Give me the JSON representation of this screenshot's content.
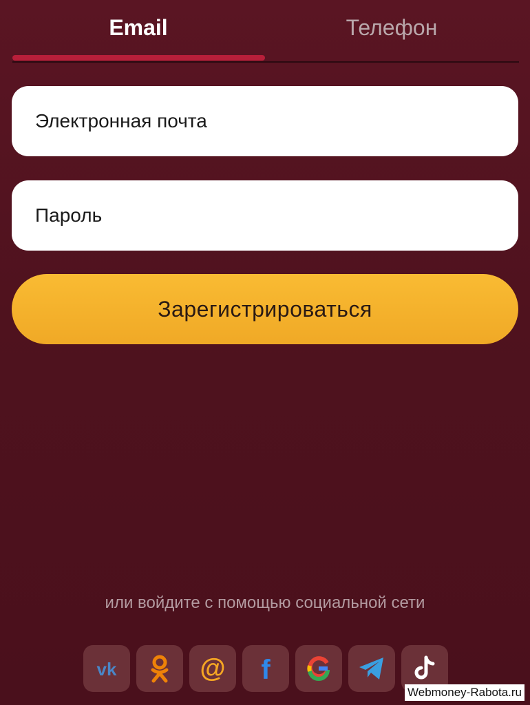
{
  "tabs": {
    "email_label": "Email",
    "phone_label": "Телефон",
    "active": "email"
  },
  "form": {
    "email_placeholder": "Электронная почта",
    "email_value": "",
    "password_placeholder": "Пароль",
    "password_value": "",
    "submit_label": "Зарегистрироваться"
  },
  "social": {
    "caption": "или войдите с помощью социальной сети",
    "providers": [
      {
        "name": "vk-icon",
        "color": "#4a86c7"
      },
      {
        "name": "odnoklassniki-icon",
        "color": "#ee8208"
      },
      {
        "name": "mail-ru-icon",
        "color": "#f5a623"
      },
      {
        "name": "facebook-icon",
        "color": "#2f88e8"
      },
      {
        "name": "google-icon",
        "color": "#4285f4"
      },
      {
        "name": "telegram-icon",
        "color": "#3a9fe0"
      },
      {
        "name": "tiktok-icon",
        "color": "#ffffff"
      }
    ]
  },
  "watermark": "Webmoney-Rabota.ru",
  "colors": {
    "background": "#541420",
    "tab_active_underline": "#b81f3a",
    "button": "#f6b42e",
    "social_tile": "#6b3138"
  }
}
